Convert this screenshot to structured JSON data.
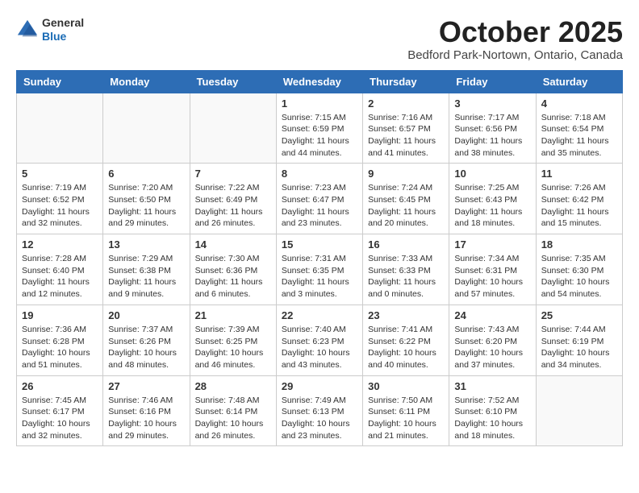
{
  "header": {
    "logo_line1": "General",
    "logo_line2": "Blue",
    "month": "October 2025",
    "location": "Bedford Park-Nortown, Ontario, Canada"
  },
  "days_of_week": [
    "Sunday",
    "Monday",
    "Tuesday",
    "Wednesday",
    "Thursday",
    "Friday",
    "Saturday"
  ],
  "weeks": [
    [
      {
        "day": "",
        "info": ""
      },
      {
        "day": "",
        "info": ""
      },
      {
        "day": "",
        "info": ""
      },
      {
        "day": "1",
        "info": "Sunrise: 7:15 AM\nSunset: 6:59 PM\nDaylight: 11 hours and 44 minutes."
      },
      {
        "day": "2",
        "info": "Sunrise: 7:16 AM\nSunset: 6:57 PM\nDaylight: 11 hours and 41 minutes."
      },
      {
        "day": "3",
        "info": "Sunrise: 7:17 AM\nSunset: 6:56 PM\nDaylight: 11 hours and 38 minutes."
      },
      {
        "day": "4",
        "info": "Sunrise: 7:18 AM\nSunset: 6:54 PM\nDaylight: 11 hours and 35 minutes."
      }
    ],
    [
      {
        "day": "5",
        "info": "Sunrise: 7:19 AM\nSunset: 6:52 PM\nDaylight: 11 hours and 32 minutes."
      },
      {
        "day": "6",
        "info": "Sunrise: 7:20 AM\nSunset: 6:50 PM\nDaylight: 11 hours and 29 minutes."
      },
      {
        "day": "7",
        "info": "Sunrise: 7:22 AM\nSunset: 6:49 PM\nDaylight: 11 hours and 26 minutes."
      },
      {
        "day": "8",
        "info": "Sunrise: 7:23 AM\nSunset: 6:47 PM\nDaylight: 11 hours and 23 minutes."
      },
      {
        "day": "9",
        "info": "Sunrise: 7:24 AM\nSunset: 6:45 PM\nDaylight: 11 hours and 20 minutes."
      },
      {
        "day": "10",
        "info": "Sunrise: 7:25 AM\nSunset: 6:43 PM\nDaylight: 11 hours and 18 minutes."
      },
      {
        "day": "11",
        "info": "Sunrise: 7:26 AM\nSunset: 6:42 PM\nDaylight: 11 hours and 15 minutes."
      }
    ],
    [
      {
        "day": "12",
        "info": "Sunrise: 7:28 AM\nSunset: 6:40 PM\nDaylight: 11 hours and 12 minutes."
      },
      {
        "day": "13",
        "info": "Sunrise: 7:29 AM\nSunset: 6:38 PM\nDaylight: 11 hours and 9 minutes."
      },
      {
        "day": "14",
        "info": "Sunrise: 7:30 AM\nSunset: 6:36 PM\nDaylight: 11 hours and 6 minutes."
      },
      {
        "day": "15",
        "info": "Sunrise: 7:31 AM\nSunset: 6:35 PM\nDaylight: 11 hours and 3 minutes."
      },
      {
        "day": "16",
        "info": "Sunrise: 7:33 AM\nSunset: 6:33 PM\nDaylight: 11 hours and 0 minutes."
      },
      {
        "day": "17",
        "info": "Sunrise: 7:34 AM\nSunset: 6:31 PM\nDaylight: 10 hours and 57 minutes."
      },
      {
        "day": "18",
        "info": "Sunrise: 7:35 AM\nSunset: 6:30 PM\nDaylight: 10 hours and 54 minutes."
      }
    ],
    [
      {
        "day": "19",
        "info": "Sunrise: 7:36 AM\nSunset: 6:28 PM\nDaylight: 10 hours and 51 minutes."
      },
      {
        "day": "20",
        "info": "Sunrise: 7:37 AM\nSunset: 6:26 PM\nDaylight: 10 hours and 48 minutes."
      },
      {
        "day": "21",
        "info": "Sunrise: 7:39 AM\nSunset: 6:25 PM\nDaylight: 10 hours and 46 minutes."
      },
      {
        "day": "22",
        "info": "Sunrise: 7:40 AM\nSunset: 6:23 PM\nDaylight: 10 hours and 43 minutes."
      },
      {
        "day": "23",
        "info": "Sunrise: 7:41 AM\nSunset: 6:22 PM\nDaylight: 10 hours and 40 minutes."
      },
      {
        "day": "24",
        "info": "Sunrise: 7:43 AM\nSunset: 6:20 PM\nDaylight: 10 hours and 37 minutes."
      },
      {
        "day": "25",
        "info": "Sunrise: 7:44 AM\nSunset: 6:19 PM\nDaylight: 10 hours and 34 minutes."
      }
    ],
    [
      {
        "day": "26",
        "info": "Sunrise: 7:45 AM\nSunset: 6:17 PM\nDaylight: 10 hours and 32 minutes."
      },
      {
        "day": "27",
        "info": "Sunrise: 7:46 AM\nSunset: 6:16 PM\nDaylight: 10 hours and 29 minutes."
      },
      {
        "day": "28",
        "info": "Sunrise: 7:48 AM\nSunset: 6:14 PM\nDaylight: 10 hours and 26 minutes."
      },
      {
        "day": "29",
        "info": "Sunrise: 7:49 AM\nSunset: 6:13 PM\nDaylight: 10 hours and 23 minutes."
      },
      {
        "day": "30",
        "info": "Sunrise: 7:50 AM\nSunset: 6:11 PM\nDaylight: 10 hours and 21 minutes."
      },
      {
        "day": "31",
        "info": "Sunrise: 7:52 AM\nSunset: 6:10 PM\nDaylight: 10 hours and 18 minutes."
      },
      {
        "day": "",
        "info": ""
      }
    ]
  ]
}
